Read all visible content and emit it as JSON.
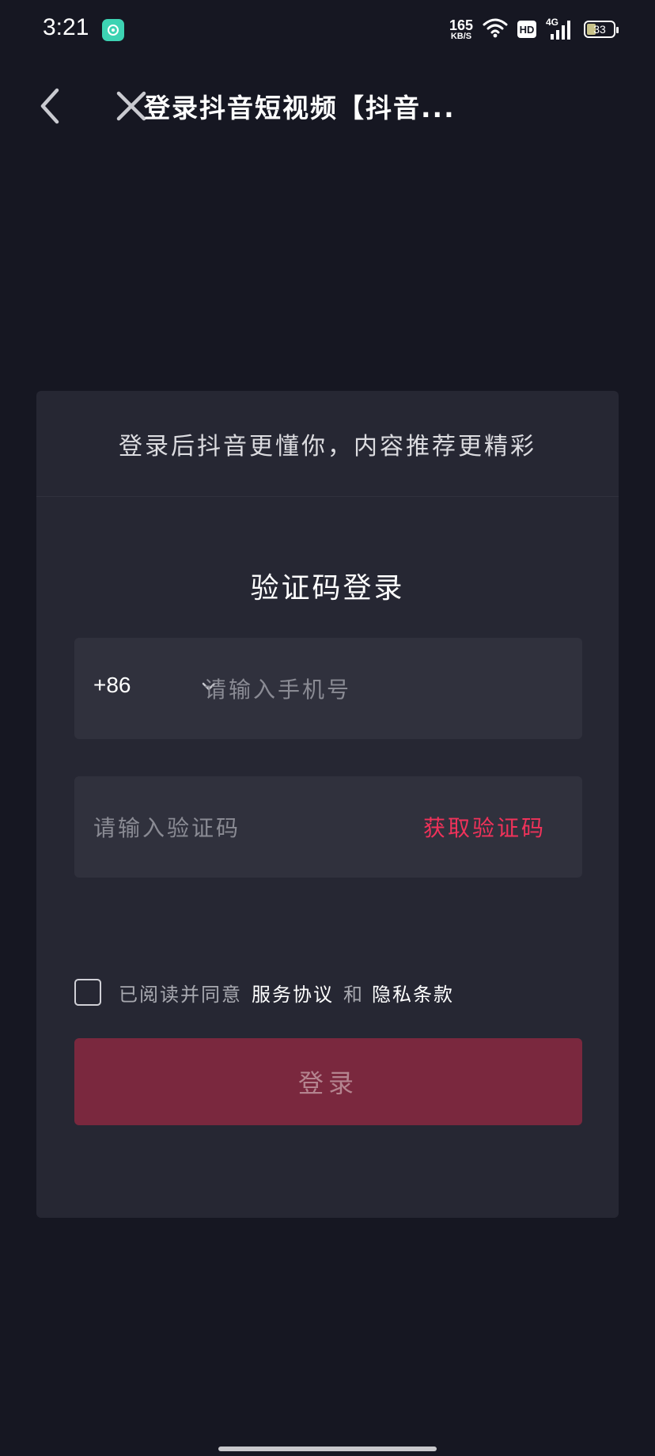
{
  "status_bar": {
    "time": "3:21",
    "net_speed_value": "165",
    "net_speed_unit": "KB/S",
    "hd": "HD",
    "network_type": "4G",
    "battery": "33"
  },
  "header": {
    "title": "登录抖音短视频【抖音..."
  },
  "card": {
    "subtitle": "登录后抖音更懂你，内容推荐更精彩",
    "heading": "验证码登录",
    "country_code": "+86",
    "phone_placeholder": "请输入手机号",
    "code_placeholder": "请输入验证码",
    "get_code_label": "获取验证码",
    "agree_prefix": "已阅读并同意",
    "terms_label": "服务协议",
    "and_label": "和",
    "privacy_label": "隐私条款",
    "login_label": "登录"
  },
  "colors": {
    "background": "#161722",
    "card": "#262733",
    "field": "#30313d",
    "accent": "#f0325a",
    "login_button": "#7a283e"
  }
}
